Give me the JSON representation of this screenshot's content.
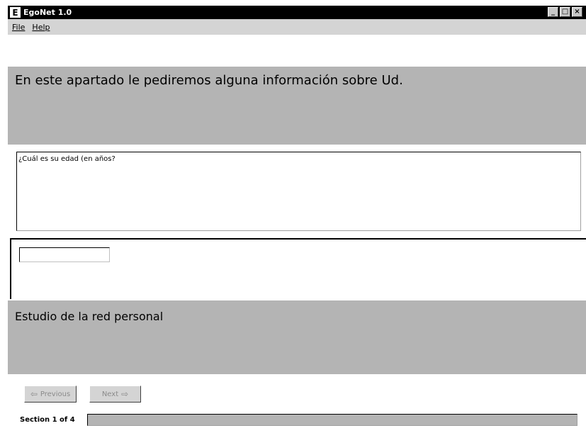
{
  "window": {
    "title": "EgoNet 1.0",
    "icon_letter": "E",
    "minimize_label": "_",
    "maximize_label": "□",
    "close_label": "×"
  },
  "menu": {
    "file_label": "File",
    "help_label": "Help"
  },
  "intro": {
    "text": "En este apartado le pediremos alguna información sobre Ud."
  },
  "question": {
    "text": "¿Cuál es su edad (en años?"
  },
  "answer": {
    "value": ""
  },
  "study": {
    "text": "Estudio de la red personal"
  },
  "navigation": {
    "previous_label": "Previous",
    "next_label": "Next",
    "previous_enabled": false,
    "next_enabled": false
  },
  "status": {
    "section_label": "Section 1 of 4",
    "progress_fraction": 0.0
  },
  "colors": {
    "panel_gray": "#b4b4b4",
    "menubar_gray": "#d4d4d4",
    "titlebar": "#000000"
  }
}
